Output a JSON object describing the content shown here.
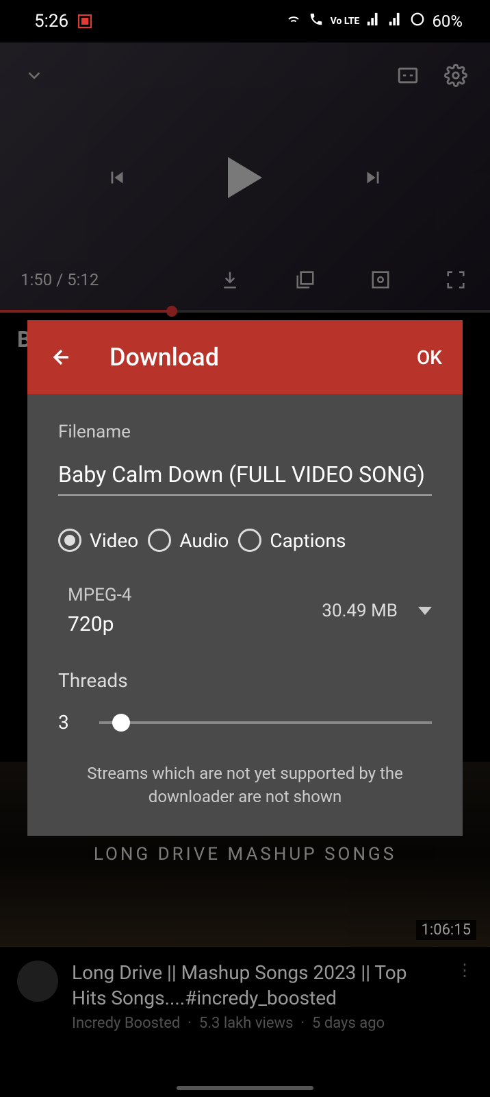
{
  "status": {
    "time": "5:26",
    "battery": "60%",
    "volte": "Vo LTE"
  },
  "player": {
    "elapsed": "1:50",
    "total": "5:12"
  },
  "background": {
    "title_prefix": "B"
  },
  "dialog": {
    "title": "Download",
    "ok": "OK",
    "filename_label": "Filename",
    "filename_value": "Baby Calm Down (FULL VIDEO SONG)",
    "radio": {
      "video": "Video",
      "audio": "Audio",
      "captions": "Captions"
    },
    "format": {
      "codec": "MPEG-4",
      "resolution": "720p",
      "size": "30.49 MB"
    },
    "threads_label": "Threads",
    "threads_value": "3",
    "note": "Streams which are not yet supported by the downloader are not shown"
  },
  "related": {
    "thumb_text": "LONG DRIVE MASHUP SONGS",
    "duration": "1:06:15",
    "title": "Long Drive || Mashup Songs 2023 || Top Hits Songs....#incredy_boosted",
    "channel": "Incredy Boosted",
    "views": "5.3 lakh views",
    "age": "5 days ago"
  }
}
